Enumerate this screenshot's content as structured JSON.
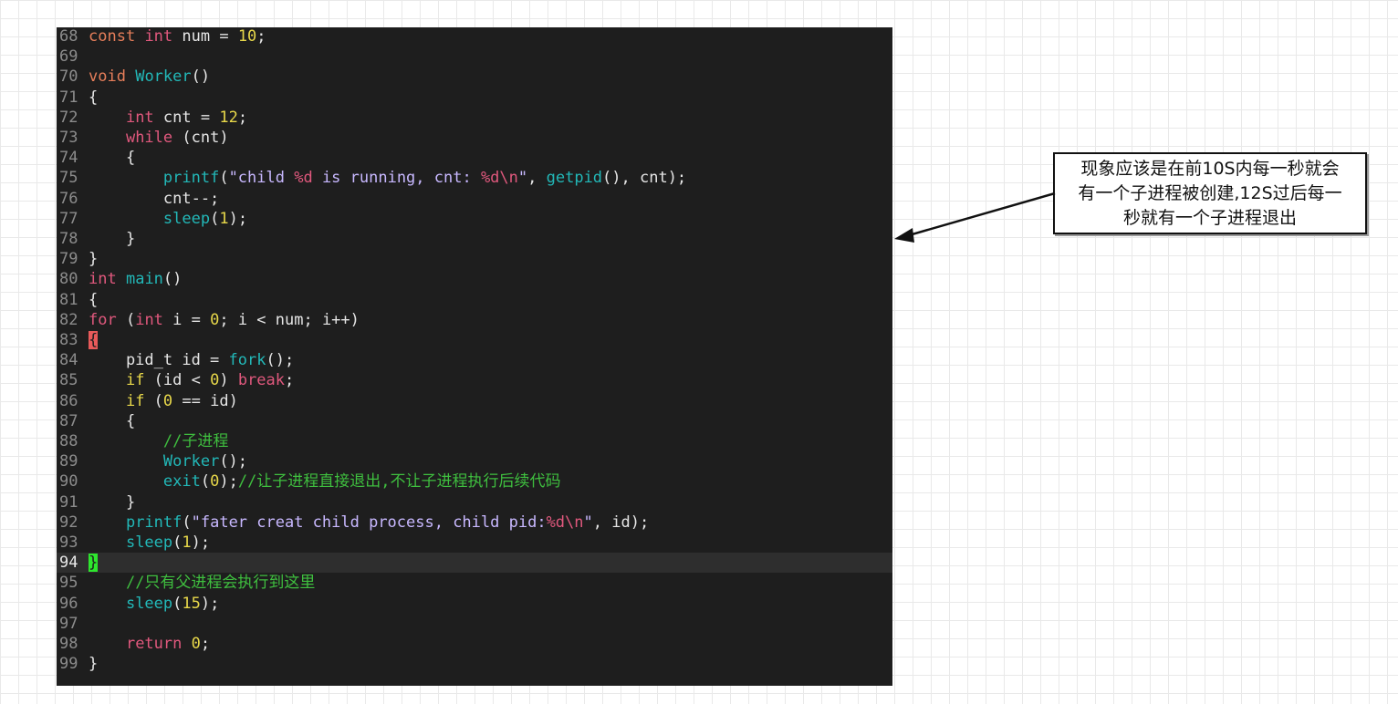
{
  "code": {
    "lines": [
      {
        "n": "68",
        "tokens": [
          [
            "k-orange",
            "const"
          ],
          [
            "",
            " "
          ],
          [
            "k-pink",
            "int"
          ],
          [
            "",
            " num = "
          ],
          [
            "k-num",
            "10"
          ],
          [
            "",
            ";"
          ]
        ]
      },
      {
        "n": "69",
        "tokens": []
      },
      {
        "n": "70",
        "tokens": [
          [
            "k-orange",
            "void"
          ],
          [
            "",
            " "
          ],
          [
            "k-teal",
            "Worker"
          ],
          [
            "",
            "()"
          ]
        ]
      },
      {
        "n": "71",
        "tokens": [
          [
            "",
            "{"
          ]
        ]
      },
      {
        "n": "72",
        "tokens": [
          [
            "",
            "    "
          ],
          [
            "k-pink",
            "int"
          ],
          [
            "",
            " cnt = "
          ],
          [
            "k-num",
            "12"
          ],
          [
            "",
            ";"
          ]
        ]
      },
      {
        "n": "73",
        "tokens": [
          [
            "",
            "    "
          ],
          [
            "k-pink",
            "while"
          ],
          [
            "",
            " (cnt)"
          ]
        ]
      },
      {
        "n": "74",
        "tokens": [
          [
            "",
            "    {"
          ]
        ]
      },
      {
        "n": "75",
        "tokens": [
          [
            "",
            "        "
          ],
          [
            "k-teal",
            "printf"
          ],
          [
            "",
            "("
          ],
          [
            "k-str",
            "\"child "
          ],
          [
            "k-fmt",
            "%d"
          ],
          [
            "k-str",
            " is running, cnt: "
          ],
          [
            "k-fmt",
            "%d\\n"
          ],
          [
            "k-str",
            "\""
          ],
          [
            "",
            ", "
          ],
          [
            "k-teal",
            "getpid"
          ],
          [
            "",
            "(), cnt);"
          ]
        ]
      },
      {
        "n": "76",
        "tokens": [
          [
            "",
            "        cnt--;"
          ]
        ]
      },
      {
        "n": "77",
        "tokens": [
          [
            "",
            "        "
          ],
          [
            "k-teal",
            "sleep"
          ],
          [
            "",
            "("
          ],
          [
            "k-num",
            "1"
          ],
          [
            "",
            ");"
          ]
        ]
      },
      {
        "n": "78",
        "tokens": [
          [
            "",
            "    }"
          ]
        ]
      },
      {
        "n": "79",
        "tokens": [
          [
            "",
            "}"
          ]
        ]
      },
      {
        "n": "80",
        "tokens": [
          [
            "k-pink",
            "int"
          ],
          [
            "",
            " "
          ],
          [
            "k-teal",
            "main"
          ],
          [
            "",
            "()"
          ]
        ]
      },
      {
        "n": "81",
        "tokens": [
          [
            "",
            "{"
          ]
        ]
      },
      {
        "n": "82",
        "tokens": [
          [
            "k-pink",
            "for"
          ],
          [
            "",
            " ("
          ],
          [
            "k-pink",
            "int"
          ],
          [
            "",
            " i = "
          ],
          [
            "k-num",
            "0"
          ],
          [
            "",
            "; i < num; i++)"
          ]
        ]
      },
      {
        "n": "83",
        "tokens": [
          [
            "brace-red",
            "{"
          ]
        ]
      },
      {
        "n": "84",
        "tokens": [
          [
            "",
            "    pid_t id = "
          ],
          [
            "k-teal",
            "fork"
          ],
          [
            "",
            "();"
          ]
        ]
      },
      {
        "n": "85",
        "tokens": [
          [
            "",
            "    "
          ],
          [
            "k-yellow",
            "if"
          ],
          [
            "",
            " (id < "
          ],
          [
            "k-num",
            "0"
          ],
          [
            "",
            ") "
          ],
          [
            "k-pink",
            "break"
          ],
          [
            "",
            ";"
          ]
        ]
      },
      {
        "n": "86",
        "tokens": [
          [
            "",
            "    "
          ],
          [
            "k-yellow",
            "if"
          ],
          [
            "",
            " ("
          ],
          [
            "k-num",
            "0"
          ],
          [
            "",
            " == id)"
          ]
        ]
      },
      {
        "n": "87",
        "tokens": [
          [
            "",
            "    {"
          ]
        ]
      },
      {
        "n": "88",
        "tokens": [
          [
            "",
            "        "
          ],
          [
            "k-cmt",
            "//子进程"
          ]
        ]
      },
      {
        "n": "89",
        "tokens": [
          [
            "",
            "        "
          ],
          [
            "k-teal",
            "Worker"
          ],
          [
            "",
            "();"
          ]
        ]
      },
      {
        "n": "90",
        "tokens": [
          [
            "",
            "        "
          ],
          [
            "k-teal",
            "exit"
          ],
          [
            "",
            "("
          ],
          [
            "k-num",
            "0"
          ],
          [
            "",
            ");"
          ],
          [
            "k-cmt",
            "//让子进程直接退出,不让子进程执行后续代码"
          ]
        ]
      },
      {
        "n": "91",
        "tokens": [
          [
            "",
            "    }"
          ]
        ]
      },
      {
        "n": "92",
        "tokens": [
          [
            "",
            "    "
          ],
          [
            "k-teal",
            "printf"
          ],
          [
            "",
            "("
          ],
          [
            "k-str",
            "\"fater creat child process, child pid:"
          ],
          [
            "k-fmt",
            "%d\\n"
          ],
          [
            "k-str",
            "\""
          ],
          [
            "",
            ", id);"
          ]
        ]
      },
      {
        "n": "93",
        "tokens": [
          [
            "",
            "    "
          ],
          [
            "k-teal",
            "sleep"
          ],
          [
            "",
            "("
          ],
          [
            "k-num",
            "1"
          ],
          [
            "",
            ");"
          ]
        ]
      },
      {
        "n": "94",
        "current": true,
        "tokens": [
          [
            "brace-green",
            "}"
          ]
        ]
      },
      {
        "n": "95",
        "tokens": [
          [
            "",
            "    "
          ],
          [
            "k-cmt",
            "//只有父进程会执行到这里"
          ]
        ]
      },
      {
        "n": "96",
        "tokens": [
          [
            "",
            "    "
          ],
          [
            "k-teal",
            "sleep"
          ],
          [
            "",
            "("
          ],
          [
            "k-num",
            "15"
          ],
          [
            "",
            ");"
          ]
        ]
      },
      {
        "n": "97",
        "tokens": []
      },
      {
        "n": "98",
        "tokens": [
          [
            "",
            "    "
          ],
          [
            "k-pink",
            "return"
          ],
          [
            "",
            " "
          ],
          [
            "k-num",
            "0"
          ],
          [
            "",
            ";"
          ]
        ]
      },
      {
        "n": "99",
        "tokens": [
          [
            "",
            "}"
          ]
        ]
      }
    ]
  },
  "callout": {
    "lines": [
      "现象应该是在前10S内每一秒就会",
      "有一个子进程被创建,12S过后每一",
      "秒就有一个子进程退出"
    ]
  }
}
